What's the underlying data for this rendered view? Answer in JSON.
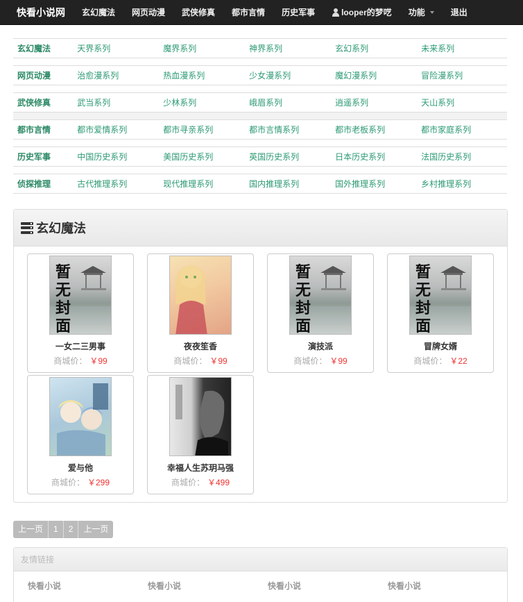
{
  "navbar": {
    "brand": "快看小说网",
    "items": [
      "玄幻魔法",
      "网页动漫",
      "武侠修真",
      "都市言情",
      "历史军事"
    ],
    "user": "looper的梦呓",
    "function_menu": "功能",
    "logout": "退出"
  },
  "categories": [
    {
      "name": "玄幻魔法",
      "links": [
        "天界系列",
        "魔界系列",
        "神界系列",
        "玄幻系列",
        "未来系列"
      ]
    },
    {
      "name": "网页动漫",
      "links": [
        "治愈漫系列",
        "热血漫系列",
        "少女漫系列",
        "魔幻漫系列",
        "冒险漫系列"
      ]
    },
    {
      "name": "武侠修真",
      "links": [
        "武当系列",
        "少林系列",
        "峨眉系列",
        "逍遥系列",
        "天山系列"
      ]
    },
    {
      "name": "都市言情",
      "links": [
        "都市爱情系列",
        "都市寻亲系列",
        "都市言情系列",
        "都市老板系列",
        "都市家庭系列"
      ]
    },
    {
      "name": "历史军事",
      "links": [
        "中国历史系列",
        "美国历史系列",
        "英国历史系列",
        "日本历史系列",
        "法国历史系列"
      ]
    },
    {
      "name": "侦探推理",
      "links": [
        "古代推理系列",
        "现代推理系列",
        "国内推理系列",
        "国外推理系列",
        "乡村推理系列"
      ]
    }
  ],
  "panel": {
    "title": "玄幻魔法",
    "price_label": "商城价：",
    "books": [
      {
        "title": "一女二三男事",
        "price": "￥99",
        "cover": "placeholder"
      },
      {
        "title": "夜夜笙香",
        "price": "￥99",
        "cover": "anime1"
      },
      {
        "title": "演技派",
        "price": "￥99",
        "cover": "placeholder"
      },
      {
        "title": "冒牌女婿",
        "price": "￥22",
        "cover": "placeholder"
      },
      {
        "title": "爱与他",
        "price": "￥299",
        "cover": "anime2"
      },
      {
        "title": "幸福人生苏玥马强",
        "price": "￥499",
        "cover": "dark"
      }
    ],
    "placeholder_text": "暂无封面"
  },
  "pager": [
    "上一页",
    "1",
    "2",
    "上一页"
  ],
  "friend_links": {
    "title": "友情链接",
    "items": [
      "快看小说",
      "快看小说",
      "快看小说",
      "快看小说"
    ]
  }
}
